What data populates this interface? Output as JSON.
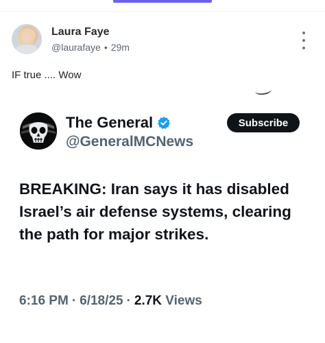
{
  "post": {
    "author_name": "Laura Faye",
    "handle": "@laurafaye",
    "separator": "•",
    "time": "29m",
    "text": "IF true .... Wow"
  },
  "embedded_tweet": {
    "display_name": "The General",
    "handle": "@GeneralMCNews",
    "subscribe_label": "Subscribe",
    "body": "BREAKING: Iran says it has disabled Israel’s air defense systems, clearing the path for major strikes.",
    "time": "6:16 PM",
    "date": "6/18/25",
    "views_count": "2.7K",
    "views_label": "Views",
    "separator": "·"
  },
  "icons": {
    "more": "more-vertical-icon",
    "verified": "verified-badge-icon",
    "avatar": "skull-avatar-icon"
  },
  "colors": {
    "tab_indicator": "#6b63e6",
    "verified_blue": "#1d9bf0",
    "subscribe_bg": "#0f1419",
    "secondary_text": "#536471"
  }
}
